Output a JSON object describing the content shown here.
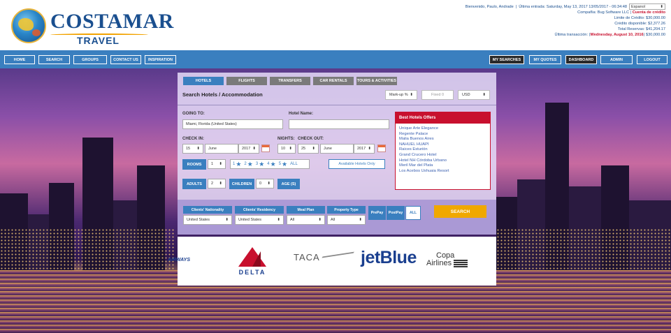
{
  "brand": {
    "name": "COSTAMAR",
    "sub": "TRAVEL"
  },
  "account": {
    "welcome": "Bienvenido, Paulo, Andrade",
    "last_login": "Última entrada: Saturday, May 13, 2017 13/05/2017 - 06:34:48",
    "language": "Espanol",
    "company_label": "Compañia: Bug Software LLC",
    "credit_account": "Cuenta de crédito",
    "credit_limit": "Limite de Crédito: $30,000.00",
    "credit_available": "Crédito disponible: $2,377.26",
    "total_reservations": "Total Reservas: $41,204.17",
    "last_transaction_prefix": "Última transacción: (",
    "last_transaction_date": "Wednesday, August 10, 2016",
    "last_transaction_suffix": ") $30,000.00"
  },
  "nav": {
    "home": "HOME",
    "search": "SEARCH",
    "groups": "GROUPS",
    "contact": "CONTACT US",
    "inspiration": "INSPIRATION",
    "my_searches": "MY SEARCHES",
    "my_quotes": "MY QUOTES",
    "dashboard": "DASHBOARD",
    "admin": "ADMIN",
    "logout": "LOGOUT"
  },
  "tabs": [
    "HOTELS",
    "FLIGHTS",
    "TRANSFERS",
    "CAR RENTALS",
    "TOURS & ACTIVITIES"
  ],
  "search": {
    "title": "Search Hotels / Accommodation",
    "markup": "Mark-up %",
    "fixed_placeholder": "Fixed 0",
    "currency": "USD",
    "going_to_label": "GOING TO:",
    "going_to_value": "Miami, Florida (United States)",
    "hotel_name_label": "Hotel Name:",
    "hotel_name_value": "",
    "check_in_label": "CHECK IN:",
    "nights_label": "NIGHTS:",
    "check_out_label": "CHECK OUT:",
    "check_in": {
      "day": "15",
      "month": "June",
      "year": "2017"
    },
    "nights": "10",
    "check_out": {
      "day": "25",
      "month": "June",
      "year": "2017"
    },
    "rooms_label": "ROOMS",
    "rooms": "1",
    "stars": [
      "1",
      "2",
      "3",
      "4",
      "5"
    ],
    "stars_all": "ALL",
    "available_only": "Available Hotels Only",
    "adults_label": "ADULTS",
    "adults": "2",
    "children_label": "CHILDREN",
    "children": "0",
    "age_label": "AGE (S)"
  },
  "offers": {
    "title": "Best Hotels Offers",
    "items": [
      "Unique Arte Elegance",
      "Regente Palace",
      "Malia Buenos Aires",
      "NAHUEL HUAPI",
      "Raices Esturión",
      "Grand Crucero Hotel",
      "Hotel NH Córdoba Urbano",
      "Meril Mar del Plata",
      "Los Acebos Ushuaia Resort"
    ]
  },
  "filters": {
    "nationality_label": "Clients' Nationality",
    "nationality": "United States",
    "residency_label": "Clients' Residency",
    "residency": "United States",
    "meal_label": "Meal Plan",
    "meal": "All",
    "property_label": "Property Type",
    "property": "All",
    "prepay": "PrePay",
    "postpay": "PostPay",
    "all": "ALL",
    "search": "SEARCH"
  },
  "airlines": {
    "ba": "AIRWAYS",
    "delta": "DELTA",
    "taca": "TACA",
    "jetblue": "jetBlue",
    "copa1": "Copa",
    "copa2": "Airlines"
  }
}
